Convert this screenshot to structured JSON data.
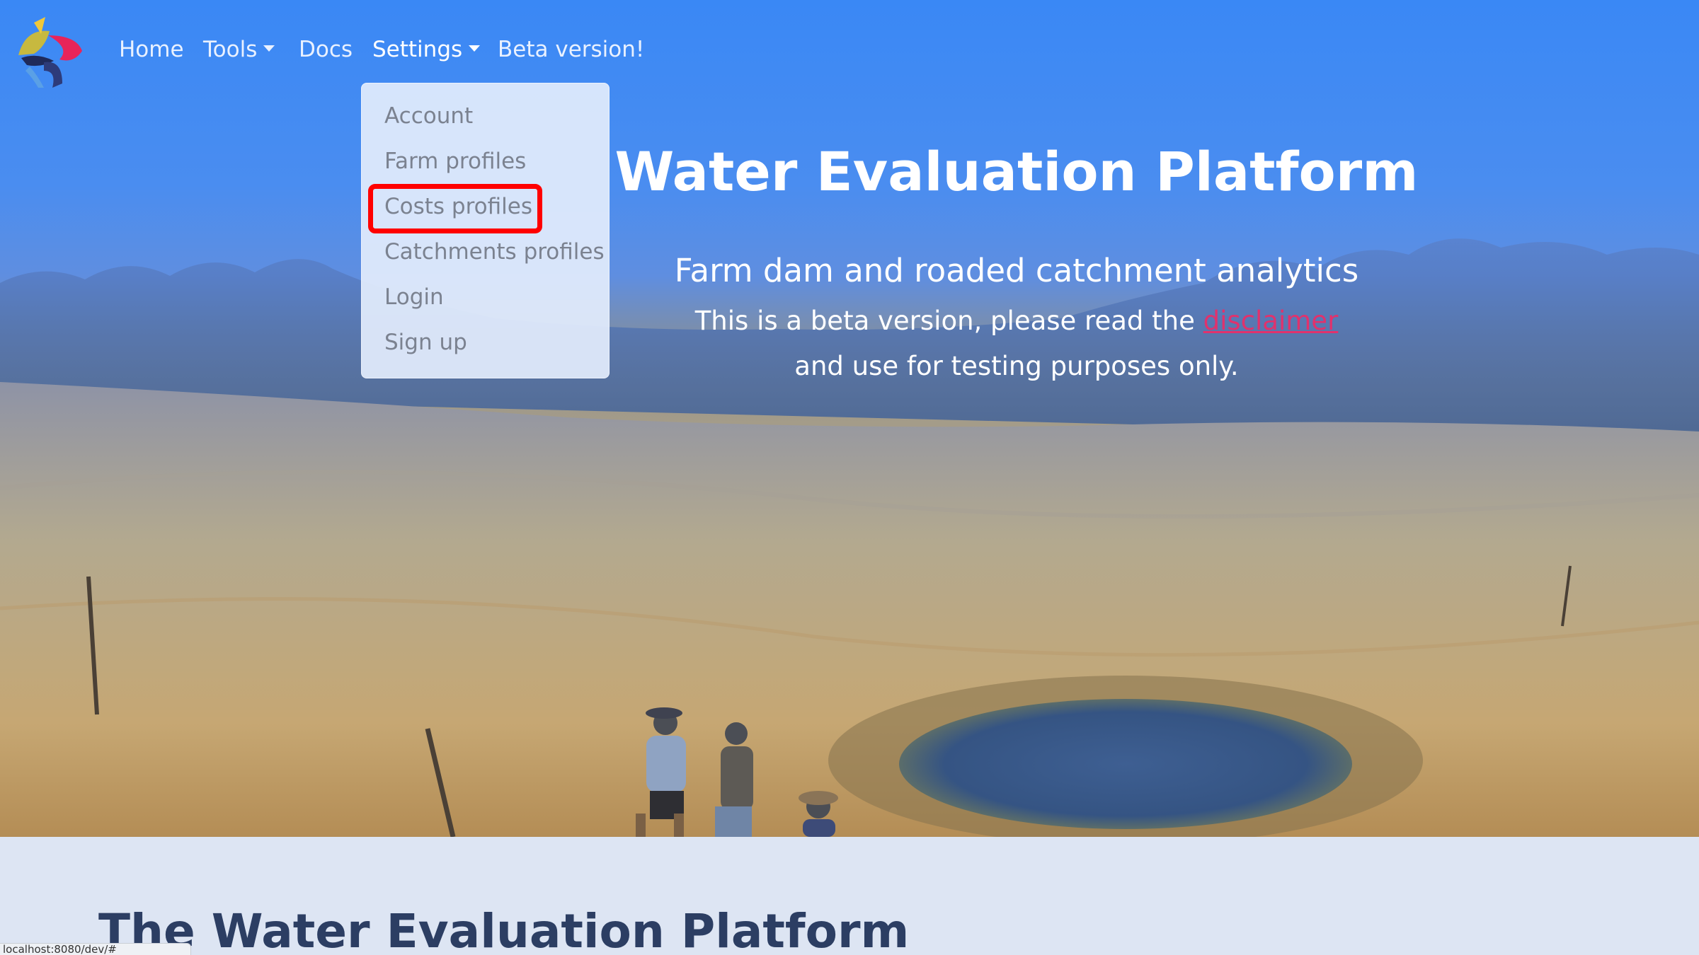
{
  "nav": {
    "home": "Home",
    "tools": "Tools",
    "docs": "Docs",
    "settings": "Settings",
    "beta": "Beta version!"
  },
  "settings_menu": {
    "items": [
      "Account",
      "Farm profiles",
      "Costs profiles",
      "Catchments profiles",
      "Login",
      "Sign up"
    ],
    "highlighted": "Costs profiles"
  },
  "hero": {
    "title": "Water Evaluation Platform",
    "subtitle": "Farm dam and roaded catchment analytics",
    "line1_prefix": "This is a beta version, please read the ",
    "disclaimer_link": "disclaimer",
    "line2": "and use for testing purposes only."
  },
  "section": {
    "title": "The Water Evaluation Platform"
  },
  "status_bar": {
    "url": "localhost:8080/dev/#"
  },
  "colors": {
    "sky": "#3a88f5",
    "link_accent": "#e0326d",
    "highlight": "#ff0000",
    "section_bg": "#dde5f3"
  }
}
